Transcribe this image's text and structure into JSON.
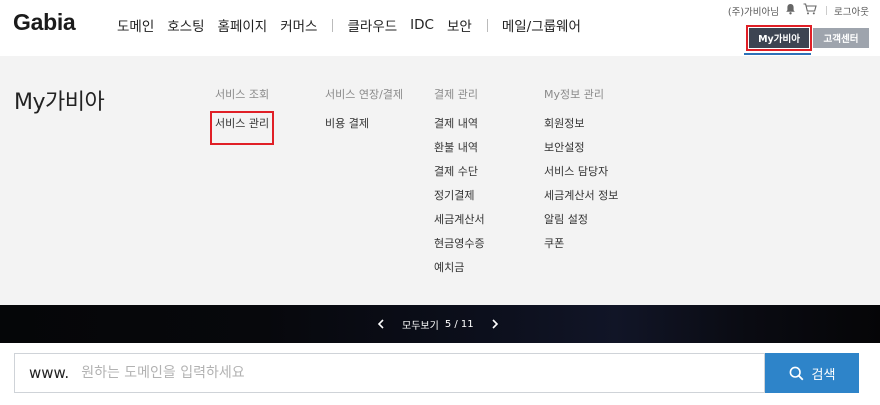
{
  "header": {
    "logo": "Gabia",
    "nav": [
      "도메인",
      "호스팅",
      "홈페이지",
      "커머스",
      "클라우드",
      "IDC",
      "보안",
      "메일/그룹웨어"
    ],
    "user_name": "(주)가비아님",
    "logout_label": "로그아웃",
    "mygabia_label": "My가비아",
    "support_label": "고객센터",
    "accent_color": "#2d71b8",
    "highlight_color": "#e01f26"
  },
  "menu": {
    "title": "My가비아",
    "columns": [
      {
        "heading": "서비스 조회",
        "items": [
          "서비스 관리"
        ]
      },
      {
        "heading": "서비스 연장/결제",
        "items": [
          "비용 결제"
        ]
      },
      {
        "heading": "결제 관리",
        "items": [
          "결제 내역",
          "환불 내역",
          "결제 수단",
          "정기결제",
          "세금계산서",
          "현금영수증",
          "예치금"
        ]
      },
      {
        "heading": "My정보 관리",
        "items": [
          "회원정보",
          "보안설정",
          "서비스 담당자",
          "세금계산서 정보",
          "알림 설정",
          "쿠폰"
        ]
      }
    ]
  },
  "banner": {
    "view_all_label": "모두보기",
    "page_count": "5 / 11"
  },
  "search": {
    "prefix": "www.",
    "placeholder": "원하는 도메인을 입력하세요",
    "button_label": "검색",
    "button_color": "#2e84c9"
  },
  "icons": [
    "bell-icon",
    "cart-icon",
    "chevron-left-icon",
    "chevron-right-icon",
    "search-icon"
  ]
}
